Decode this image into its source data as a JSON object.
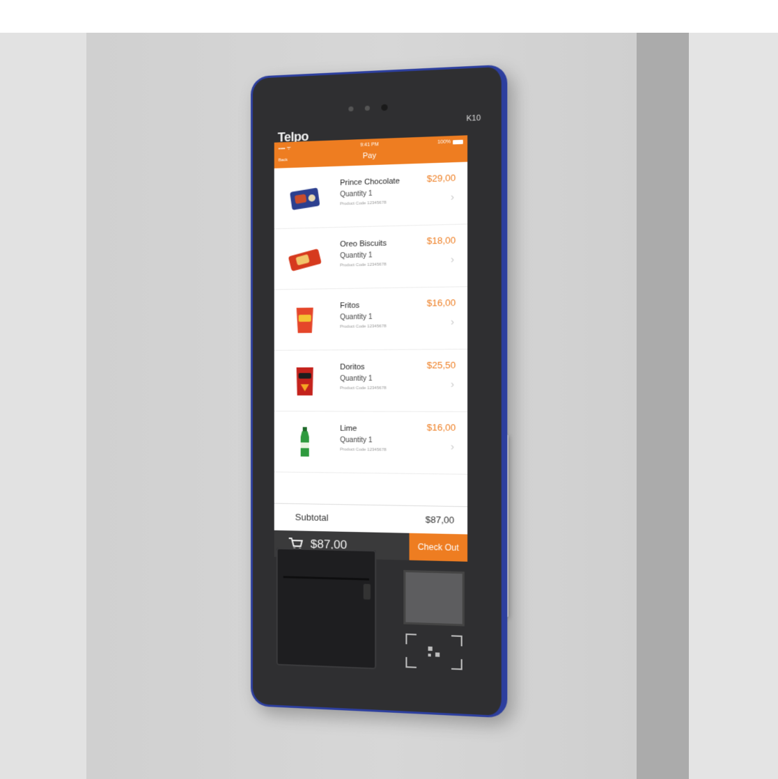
{
  "device": {
    "brand": "Telpo",
    "model": "K10"
  },
  "status_bar": {
    "carrier": "•••• ᯤ",
    "time": "9:41 PM",
    "battery": "100%"
  },
  "nav": {
    "back_label": "Back",
    "title": "Pay"
  },
  "items": [
    {
      "name": "Prince Chocolate",
      "quantity": "Quantity 1",
      "description": "Product Code 12345678",
      "price": "$29,00",
      "icon": "cookie-box-icon",
      "color": "#2c3f8f"
    },
    {
      "name": "Oreo Biscuits",
      "quantity": "Quantity 1",
      "description": "Product Code 12345678",
      "price": "$18,00",
      "icon": "biscuit-pack-icon",
      "color": "#d63a1e"
    },
    {
      "name": "Fritos",
      "quantity": "Quantity 1",
      "description": "Product Code 12345678",
      "price": "$16,00",
      "icon": "chips-bag-icon",
      "color": "#e5462a"
    },
    {
      "name": "Doritos",
      "quantity": "Quantity 1",
      "description": "Product Code 12345678",
      "price": "$25,50",
      "icon": "chips-bag-icon",
      "color": "#c4221c"
    },
    {
      "name": "Lime",
      "quantity": "Quantity 1",
      "description": "Product Code 12345678",
      "price": "$16,00",
      "icon": "soda-bottle-icon",
      "color": "#2e9a3e"
    }
  ],
  "subtotal": {
    "label": "Subtotal",
    "value": "$87,00"
  },
  "cart": {
    "total": "$87,00",
    "checkout_label": "Check Out"
  },
  "colors": {
    "accent": "#ee7d21",
    "bezel": "#2f2f31",
    "frame": "#2d3f9e"
  }
}
